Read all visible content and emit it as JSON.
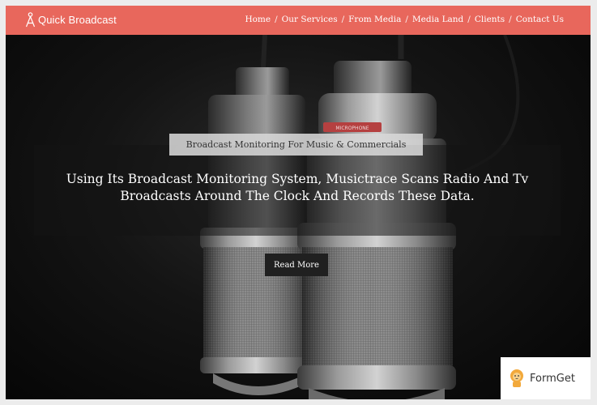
{
  "brand": {
    "name": "Quick Broadcast",
    "icon": "broadcast-tower-icon"
  },
  "nav": {
    "items": [
      {
        "label": "Home"
      },
      {
        "label": "Our Services"
      },
      {
        "label": "From Media"
      },
      {
        "label": "Media Land"
      },
      {
        "label": "Clients"
      },
      {
        "label": "Contact Us"
      }
    ],
    "separator": "/"
  },
  "hero": {
    "tagline": "Broadcast Monitoring For Music & Commercials",
    "headline_line1": "Using Its Broadcast Monitoring System, Musictrace Scans Radio And Tv",
    "headline_line2": "Broadcasts Around The Clock And Records These Data.",
    "cta_label": "Read More",
    "mic_label": "MICROPHONE"
  },
  "badge": {
    "label": "FormGet",
    "icon": "lion-mascot-icon"
  },
  "colors": {
    "nav_bg": "#e8675c",
    "text": "#ffffff",
    "tagline_bg": "#d7d7d7",
    "button_bg": "#202020"
  }
}
